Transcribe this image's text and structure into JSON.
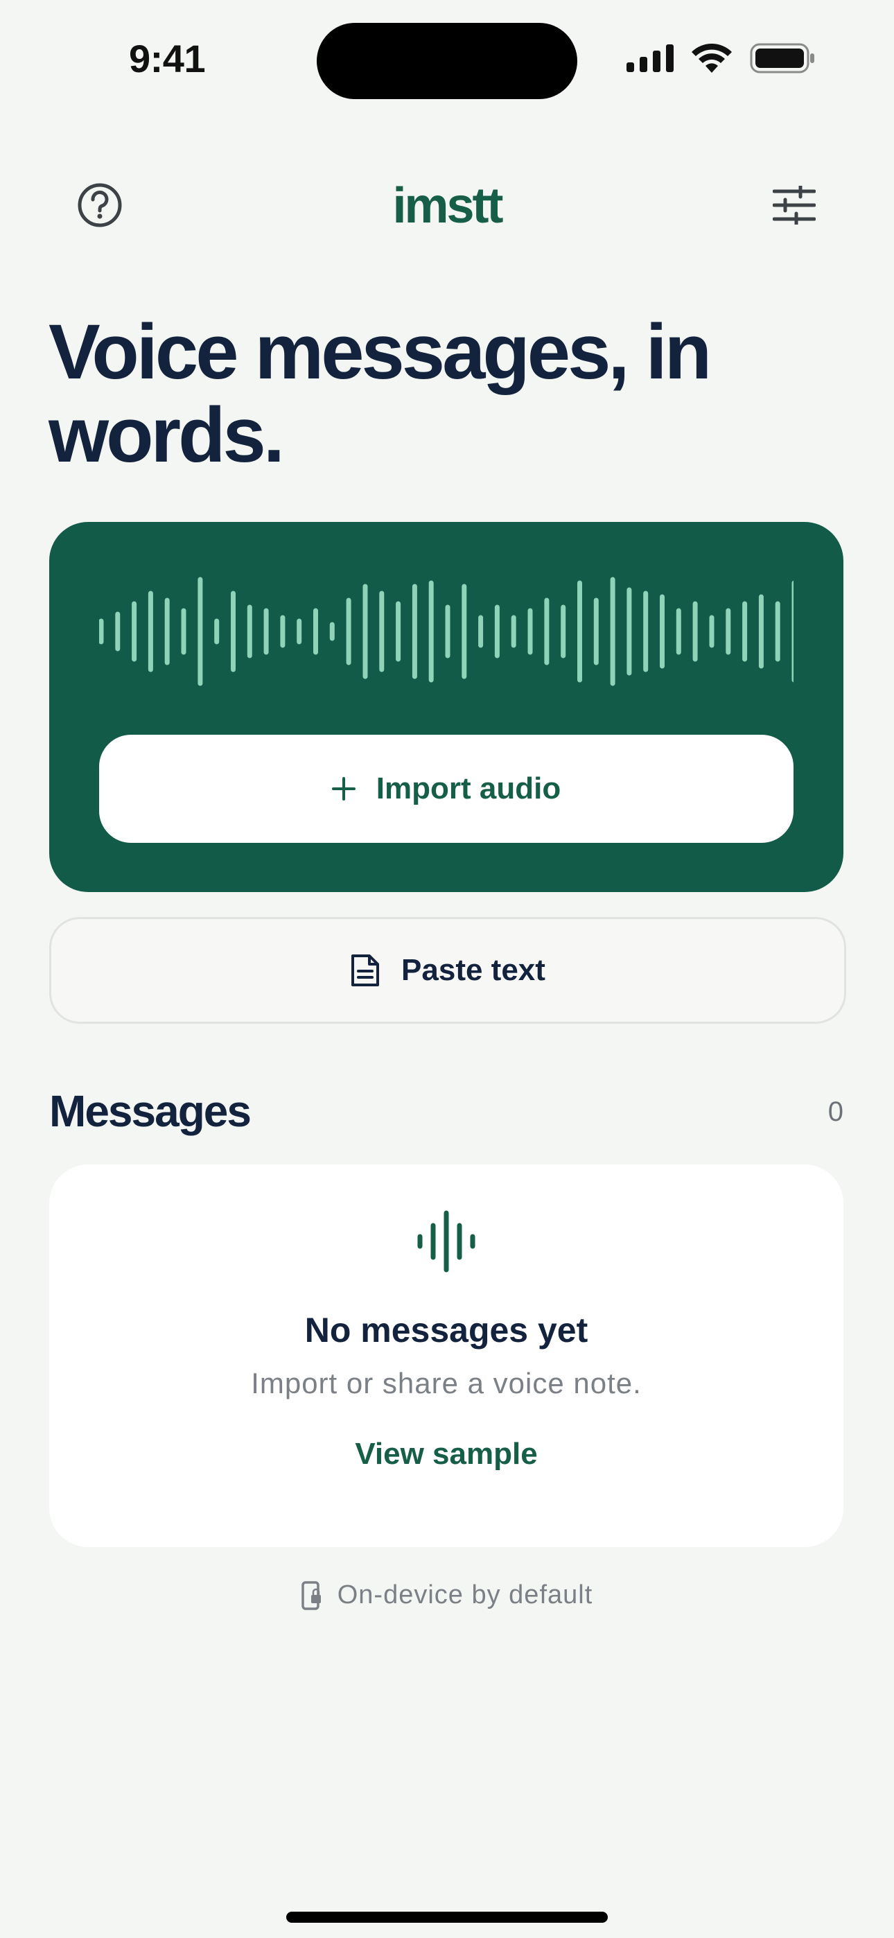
{
  "status_bar": {
    "time": "9:41",
    "icons": [
      "cellular-signal-icon",
      "wifi-icon",
      "battery-icon"
    ]
  },
  "header": {
    "title": "imstt",
    "left_icon": "help-circle-icon",
    "right_icon": "sliders-icon"
  },
  "headline": "Voice messages, in words.",
  "hero": {
    "import_label": "Import audio",
    "import_icon": "plus-icon",
    "waveform_icon": "waveform-icon"
  },
  "paste": {
    "label": "Paste text",
    "icon": "document-icon"
  },
  "messages": {
    "title": "Messages",
    "count": "0",
    "empty": {
      "icon": "audio-waveform-icon",
      "title": "No messages yet",
      "subtitle": "Import or share a voice note.",
      "action_label": "View sample"
    }
  },
  "footer": {
    "note": "On-device by default",
    "icon": "phone-lock-icon"
  },
  "colors": {
    "brand_green": "#125b48",
    "accent_green": "#165e48",
    "waveform_bar": "#8fd3b8",
    "text_dark": "#14233d",
    "background": "#f4f6f3"
  }
}
